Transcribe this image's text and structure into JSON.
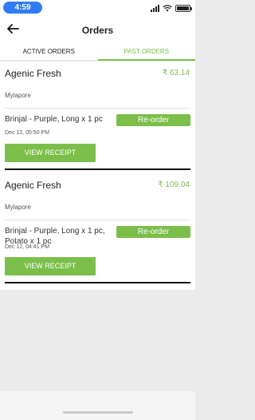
{
  "status_bar": {
    "time": "4:59"
  },
  "header": {
    "title": "Orders"
  },
  "tabs": [
    {
      "label": "ACTIVE ORDERS",
      "active": false
    },
    {
      "label": "PAST ORDERS",
      "active": true
    }
  ],
  "orders": [
    {
      "store": "Agenic Fresh",
      "amount": "₹ 63.14",
      "location": "Mylapore",
      "items": "Brinjal - Purple, Long x 1 pc",
      "reorder_label": "Re-order",
      "date": "Dec 12, 05:50 PM",
      "receipt_label": "VIEW RECEIPT"
    },
    {
      "store": "Agenic Fresh",
      "amount": "₹ 109.04",
      "location": "Mylapore",
      "items": "Brinjal - Purple, Long x 1 pc, Potato x 1 pc",
      "reorder_label": "Re-order",
      "date": "Dec 12, 04:41 PM",
      "receipt_label": "VIEW RECEIPT"
    }
  ],
  "colors": {
    "accent": "#7bbf4a",
    "time_pill": "#2f7cf6"
  }
}
